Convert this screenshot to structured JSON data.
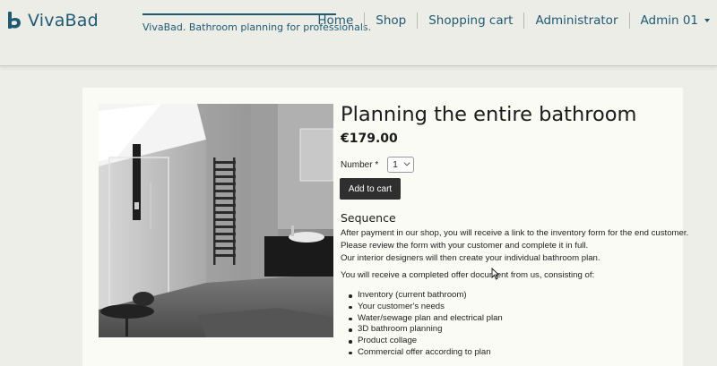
{
  "header": {
    "brand_name": "VivaBad",
    "tagline": "VivaBad. Bathroom planning for professionals.",
    "nav": [
      {
        "label": "Home"
      },
      {
        "label": "Shop"
      },
      {
        "label": "Shopping cart"
      },
      {
        "label": "Administrator"
      },
      {
        "label": "Admin 01"
      }
    ]
  },
  "product": {
    "title": "Planning the entire bathroom",
    "price": "€179.00",
    "number_label": "Number *",
    "quantity": "1",
    "add_to_cart_label": "Add to cart",
    "section_title": "Sequence",
    "paragraph1_lines": [
      "After payment in our shop, you will receive a link to the inventory form for the end customer.",
      "Please review the form with your customer and complete it in full.",
      "Our interior designers will then create your individual bathroom plan."
    ],
    "paragraph2": "You will receive a completed offer document from us, consisting of:",
    "deliverables": [
      "Inventory (current bathroom)",
      "Your customer's needs",
      "Water/sewage plan and electrical plan",
      "3D bathroom planning",
      "Product collage",
      "Commercial offer according to plan"
    ]
  },
  "colors": {
    "brand": "#1f5a73",
    "button": "#2f2f2f",
    "page_bg": "#eeeee8",
    "card_bg": "#fbfbf5"
  }
}
